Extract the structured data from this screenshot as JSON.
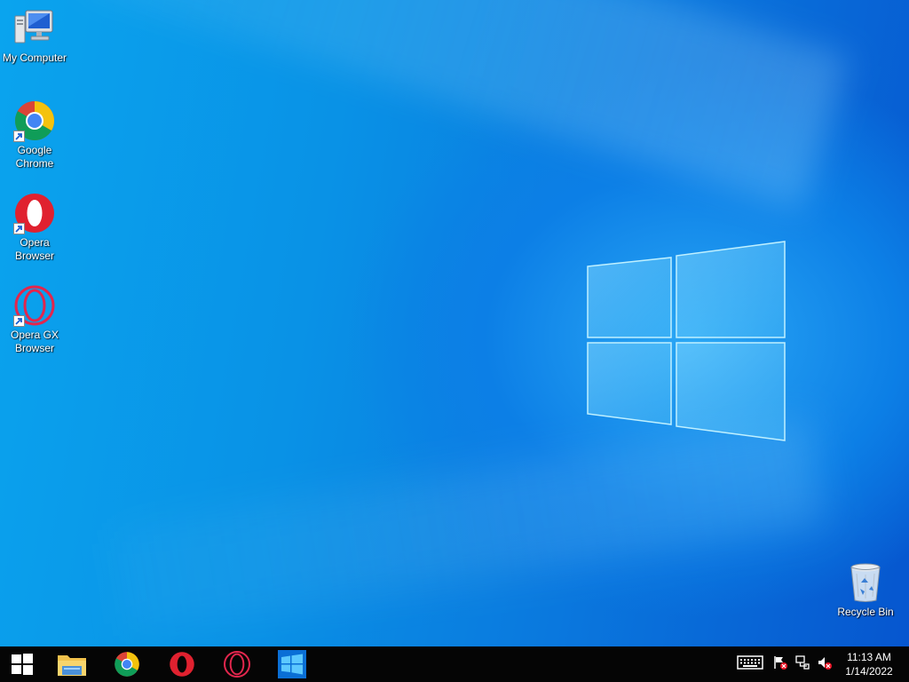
{
  "desktop_icons": {
    "my_computer": {
      "label": "My Computer",
      "icon": "computer-icon"
    },
    "chrome": {
      "label": "Google\nChrome",
      "icon": "chrome-icon"
    },
    "opera": {
      "label": "Opera\nBrowser",
      "icon": "opera-icon"
    },
    "opera_gx": {
      "label": "Opera GX\nBrowser",
      "icon": "opera-gx-icon"
    },
    "recycle_bin": {
      "label": "Recycle Bin",
      "icon": "recycle-bin-icon"
    }
  },
  "taskbar": {
    "start": {
      "icon": "windows-start-icon"
    },
    "pinned": [
      {
        "name": "File Explorer",
        "icon": "folder-icon"
      },
      {
        "name": "Google Chrome",
        "icon": "chrome-icon"
      },
      {
        "name": "Opera",
        "icon": "opera-icon"
      },
      {
        "name": "Opera GX",
        "icon": "opera-gx-icon"
      },
      {
        "name": "Windows",
        "icon": "windows-logo-icon"
      }
    ],
    "tray": {
      "icons": [
        "keyboard-icon",
        "action-center-flag-icon",
        "network-icon",
        "volume-muted-icon"
      ],
      "time": "11:13 AM",
      "date": "1/14/2022"
    }
  },
  "colors": {
    "desktop_primary": "#0a8fe6",
    "taskbar_bg": "#050505",
    "chrome_red": "#db4437",
    "chrome_yellow": "#f4c20d",
    "chrome_green": "#0f9d58",
    "chrome_blue": "#4285f4",
    "opera_red": "#e0212f"
  }
}
